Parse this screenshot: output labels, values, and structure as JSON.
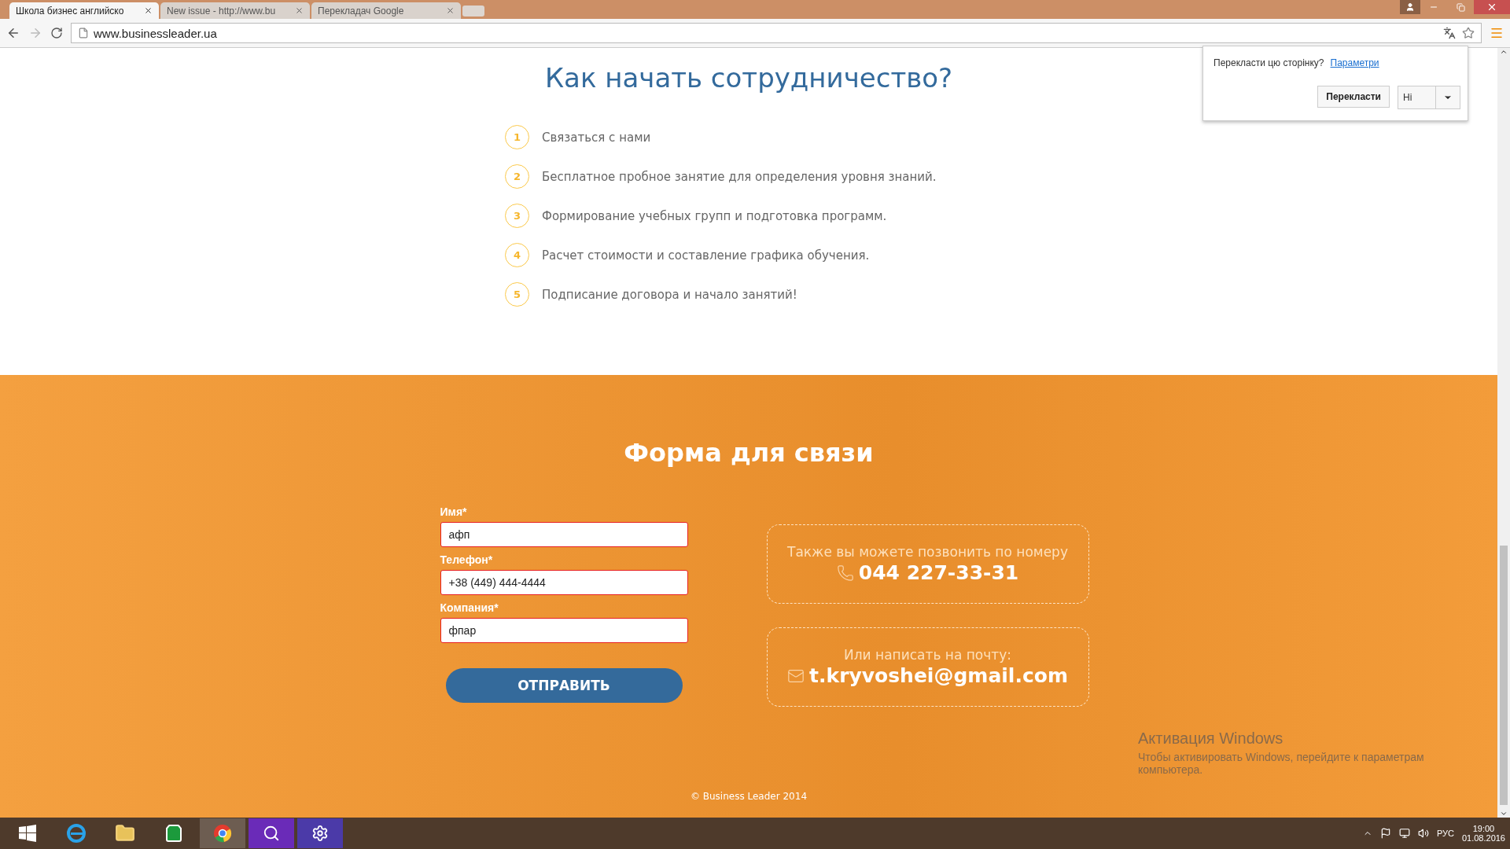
{
  "browser": {
    "tabs": [
      {
        "title": "Школа бизнес английско",
        "selected": true
      },
      {
        "title": "New issue - http://www.bu",
        "selected": false
      },
      {
        "title": "Перекладач Google",
        "selected": false
      }
    ],
    "address": "www.businessleader.ua"
  },
  "translate_popup": {
    "question": "Перекласти цю сторінку?",
    "options_link": "Параметри",
    "translate_button": "Перекласти",
    "decline_button": "Ні"
  },
  "steps": {
    "title": "Как начать сотрудничество?",
    "items": [
      {
        "number": "1",
        "text": "Связаться с нами"
      },
      {
        "number": "2",
        "text": "Бесплатное пробное занятие для определения уровня знаний."
      },
      {
        "number": "3",
        "text": "Формирование учебных групп и подготовка программ."
      },
      {
        "number": "4",
        "text": "Расчет стоимости и составление графика обучения."
      },
      {
        "number": "5",
        "text": "Подписание договора и начало занятий!"
      }
    ]
  },
  "contact_form": {
    "title": "Форма для связи",
    "fields": [
      {
        "label": "Имя*",
        "value": "афп"
      },
      {
        "label": "Телефон*",
        "value": "+38 (449) 444-4444"
      },
      {
        "label": "Компания*",
        "value": "фпар"
      }
    ],
    "submit": "ОТПРАВИТЬ",
    "contacts": [
      {
        "kind": "phone",
        "caption": "Также вы можете позвонить по номеру",
        "value": "044 227-33-31"
      },
      {
        "kind": "email",
        "caption": "Или написать на почту:",
        "value": "t.kryvoshei@gmail.com"
      }
    ],
    "copyright": "© Business Leader 2014"
  },
  "activation_notice": {
    "title": "Активация Windows",
    "text": "Чтобы активировать Windows, перейдите к параметрам компьютера."
  },
  "taskbar": {
    "language": "РУС",
    "time": "19:00",
    "date": "01.08.2016"
  }
}
